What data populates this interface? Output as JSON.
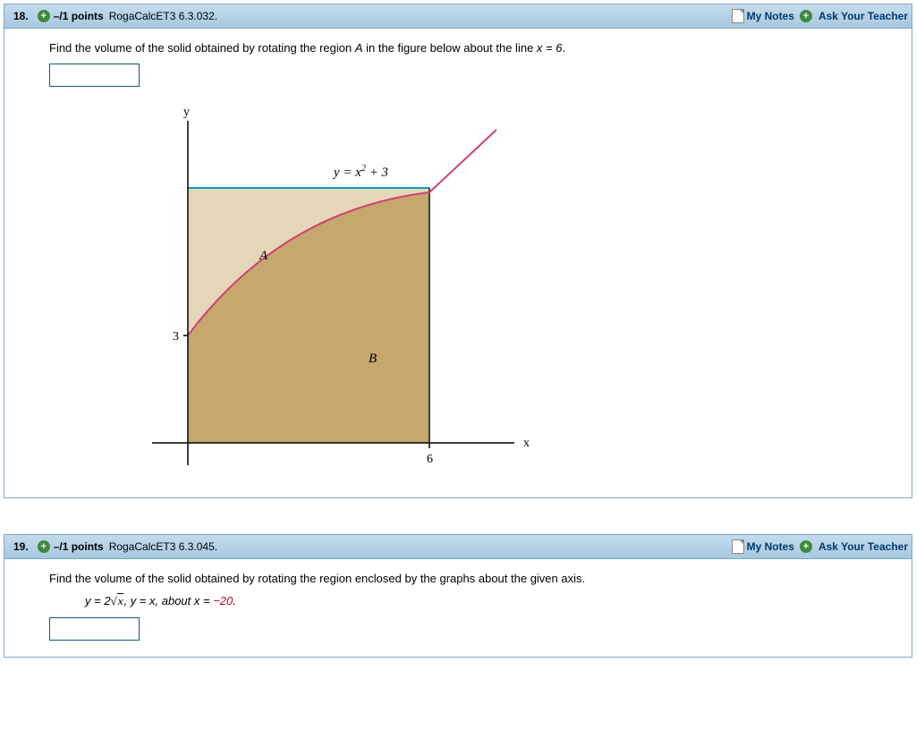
{
  "questions": [
    {
      "number": "18.",
      "points": "–/1 points",
      "reference": "RogaCalcET3 6.3.032.",
      "my_notes": "My Notes",
      "ask_teacher": "Ask Your Teacher",
      "prompt_before": "Find the volume of the solid obtained by rotating the region ",
      "region": "A",
      "prompt_after": " in the figure below about the line ",
      "line_eq": "x = 6",
      "period": ".",
      "figure": {
        "y_label": "y",
        "x_label": "x",
        "curve_eq_prefix": "y = x",
        "curve_eq_suffix": " + 3",
        "region_A": "A",
        "region_B": "B",
        "y_tick": "3",
        "x_tick": "6"
      }
    },
    {
      "number": "19.",
      "points": "–/1 points",
      "reference": "RogaCalcET3 6.3.045.",
      "my_notes": "My Notes",
      "ask_teacher": "Ask Your Teacher",
      "prompt_before": "Find the volume of the solid obtained by rotating the region enclosed by the graphs about the given axis.",
      "curves_prefix": "y = 2",
      "curves_radicand": "x",
      "curves_mid": ", y = x,  about  x = ",
      "curves_val": "−20",
      "period": "."
    }
  ]
}
